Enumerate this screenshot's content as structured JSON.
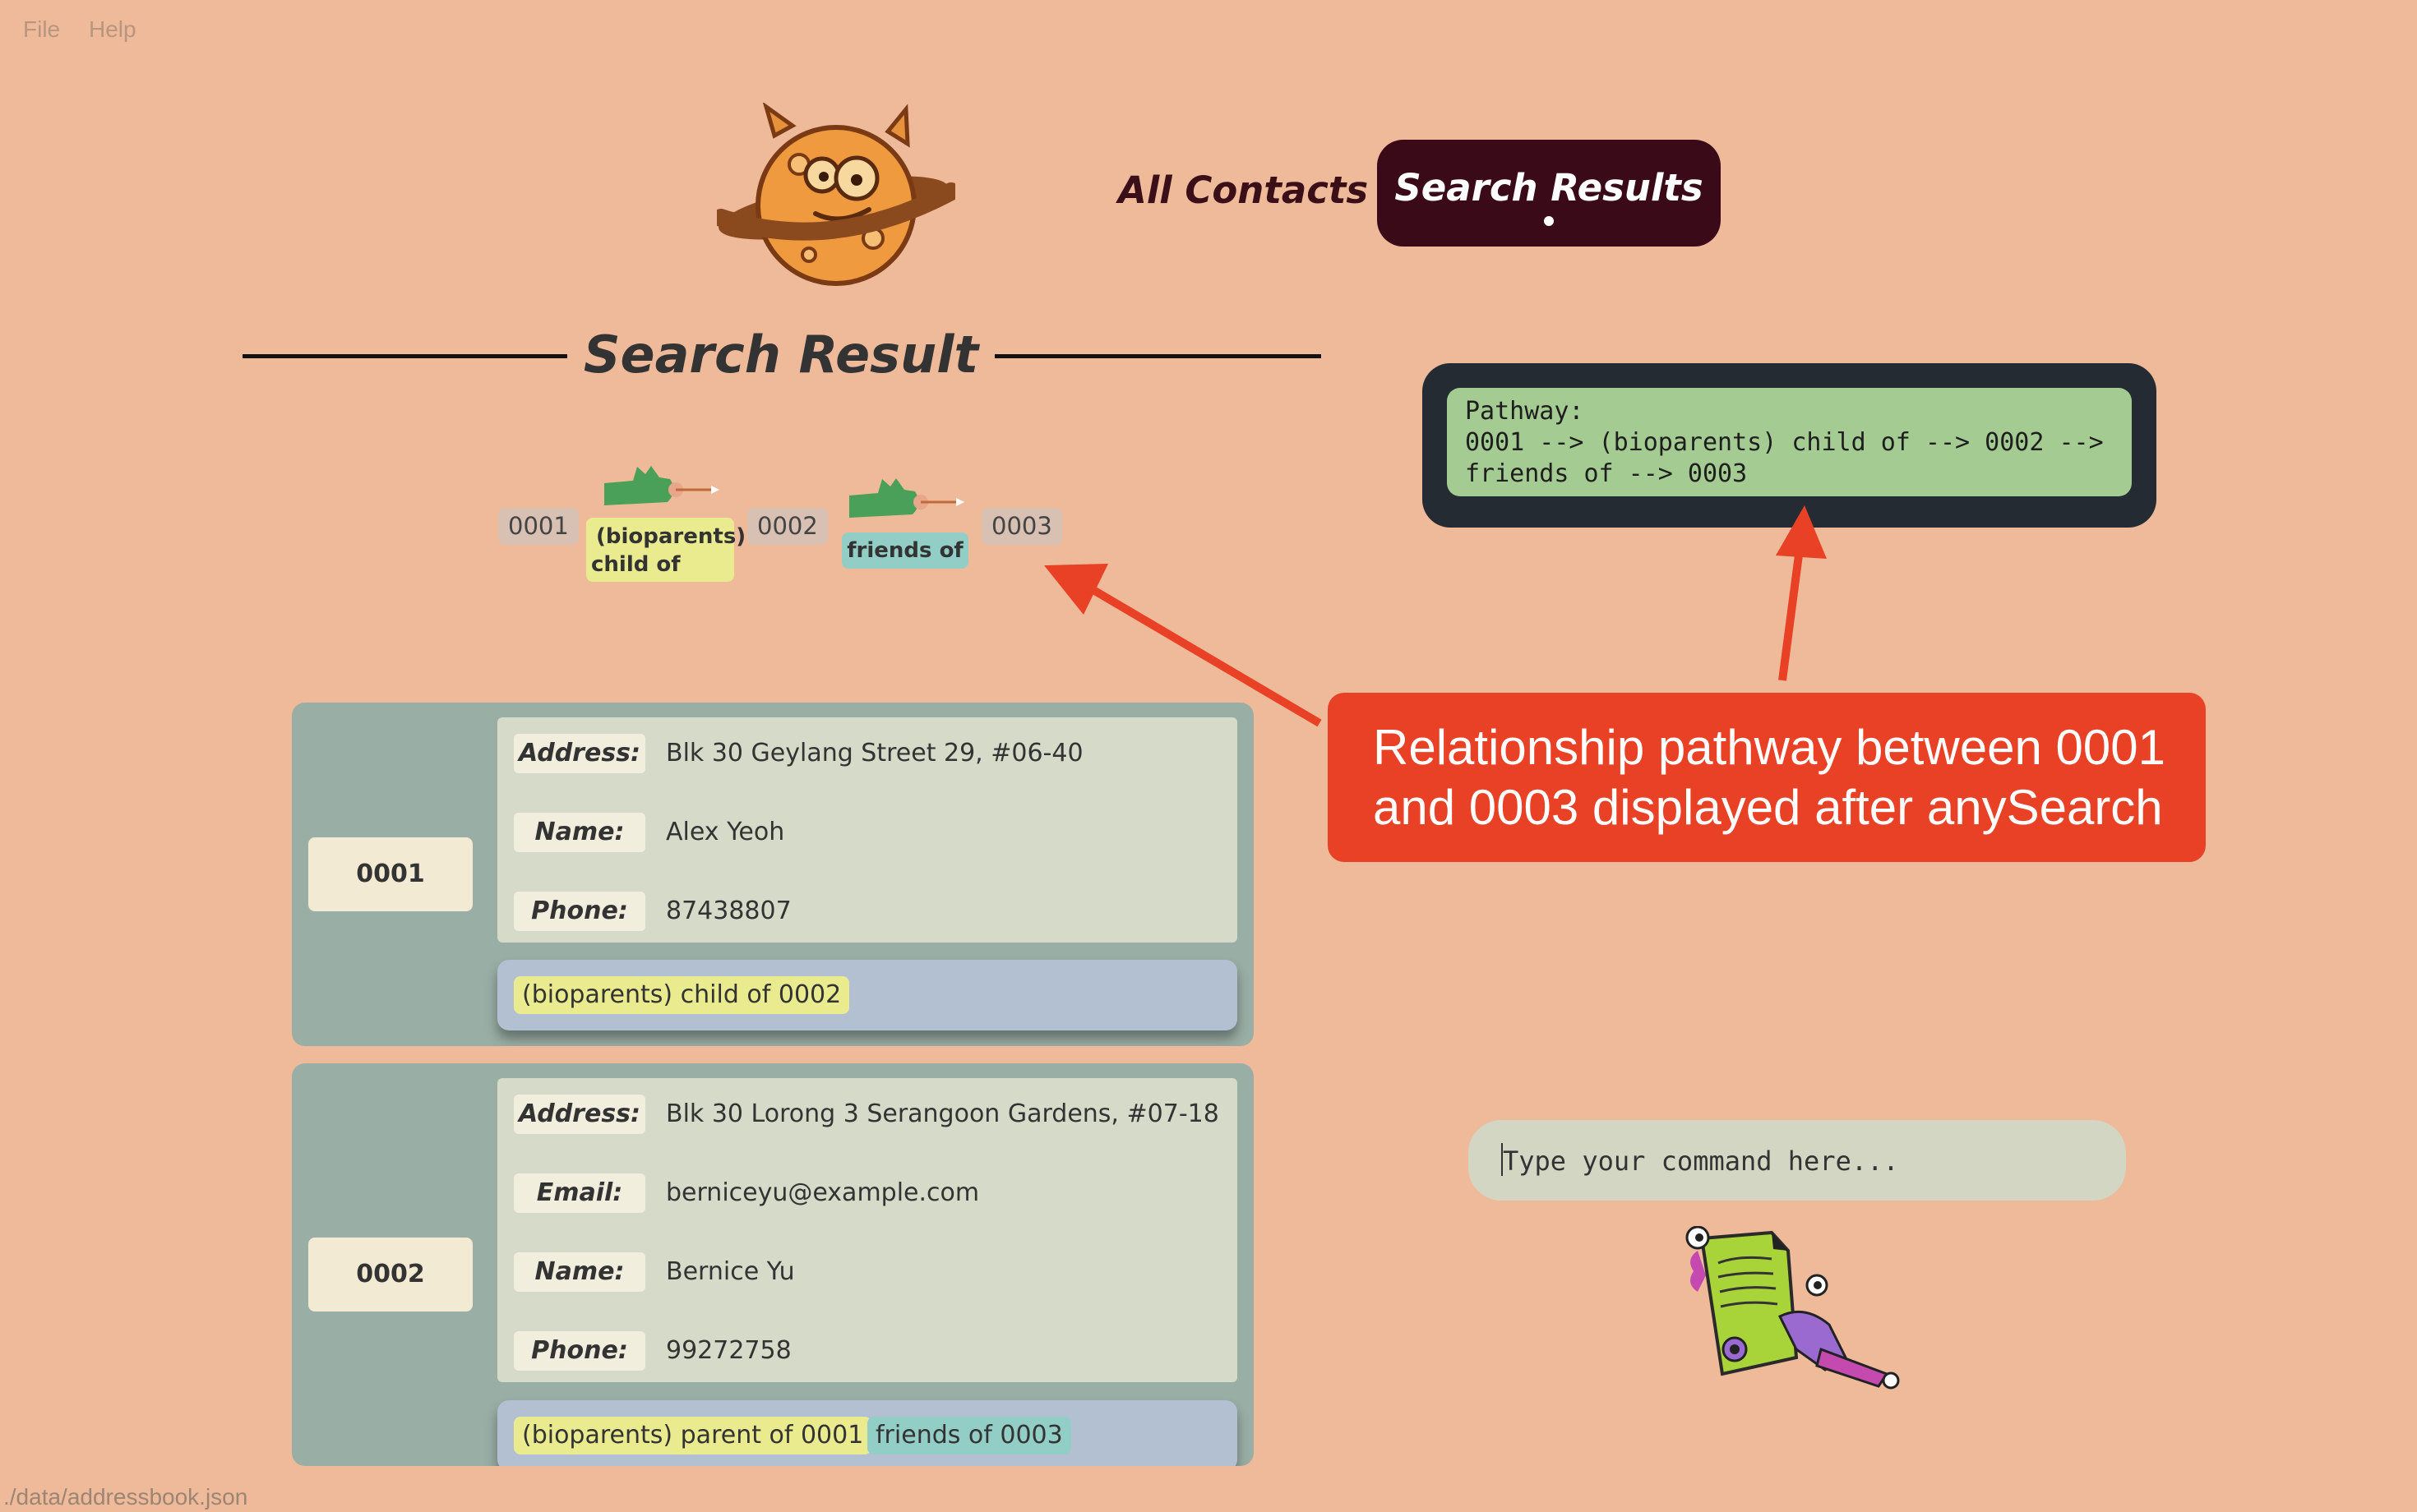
{
  "menu": {
    "file": "File",
    "help": "Help"
  },
  "nav": {
    "all_contacts": "All Contacts",
    "search_results": "Search Results"
  },
  "heading": "Search Result",
  "pathway": {
    "line1": "Pathway:",
    "line2": "0001 --> (bioparents) child of  --> 0002 -->",
    "line3": "friends of --> 0003"
  },
  "graph": {
    "nodes": [
      "0001",
      "0002",
      "0003"
    ],
    "edges": [
      {
        "label_line1": "(bioparents)",
        "label_line2": "child of",
        "color": "#eaea8e"
      },
      {
        "label_line1": "friends of",
        "color": "#92cdc6"
      }
    ]
  },
  "annotation": {
    "line1": "Relationship pathway between 0001",
    "line2": "and 0003 displayed after anySearch",
    "color": "#e94126"
  },
  "contacts": [
    {
      "id": "0001",
      "fields": [
        {
          "label": "Address:",
          "value": "Blk 30 Geylang Street 29, #06-40"
        },
        {
          "label": "Name:",
          "value": "Alex Yeoh"
        },
        {
          "label": "Phone:",
          "value": "87438807"
        }
      ],
      "tags": [
        {
          "text": "(bioparents) child of 0002",
          "kind": "yellow"
        }
      ]
    },
    {
      "id": "0002",
      "fields": [
        {
          "label": "Address:",
          "value": "Blk 30 Lorong 3 Serangoon Gardens, #07-18"
        },
        {
          "label": "Email:",
          "value": "berniceyu@example.com"
        },
        {
          "label": "Name:",
          "value": "Bernice Yu"
        },
        {
          "label": "Phone:",
          "value": "99272758"
        }
      ],
      "tags": [
        {
          "text": "(bioparents) parent of 0001",
          "kind": "yellow"
        },
        {
          "text": "friends of 0003",
          "kind": "teal"
        }
      ]
    }
  ],
  "command": {
    "placeholder": "Type your command here..."
  },
  "status_bar": {
    "path": "./data/addressbook.json"
  },
  "icons": {
    "logo": "planet-monster-logo",
    "mascot": "monster-with-document-mascot",
    "hand": "pointing-hand-icon"
  }
}
